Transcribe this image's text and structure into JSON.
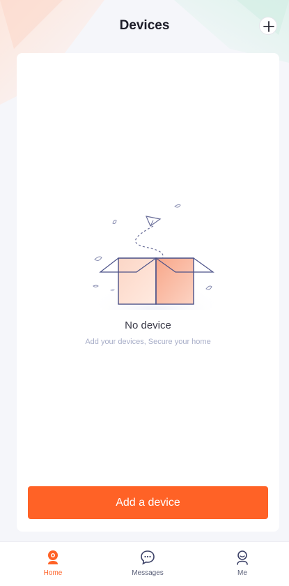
{
  "header": {
    "title": "Devices",
    "add_icon": "plus-icon"
  },
  "empty_state": {
    "illustration": "empty-box-icon",
    "title": "No device",
    "subtitle": "Add your devices, Secure your home"
  },
  "actions": {
    "add_device_label": "Add a device"
  },
  "tabbar": {
    "items": [
      {
        "label": "Home",
        "icon": "camera-icon",
        "active": true
      },
      {
        "label": "Messages",
        "icon": "chat-bubble-icon",
        "active": false
      },
      {
        "label": "Me",
        "icon": "person-icon",
        "active": false
      }
    ]
  },
  "colors": {
    "accent": "#ff6226",
    "inactive": "#5a5f78",
    "background": "#f5f6fa"
  }
}
